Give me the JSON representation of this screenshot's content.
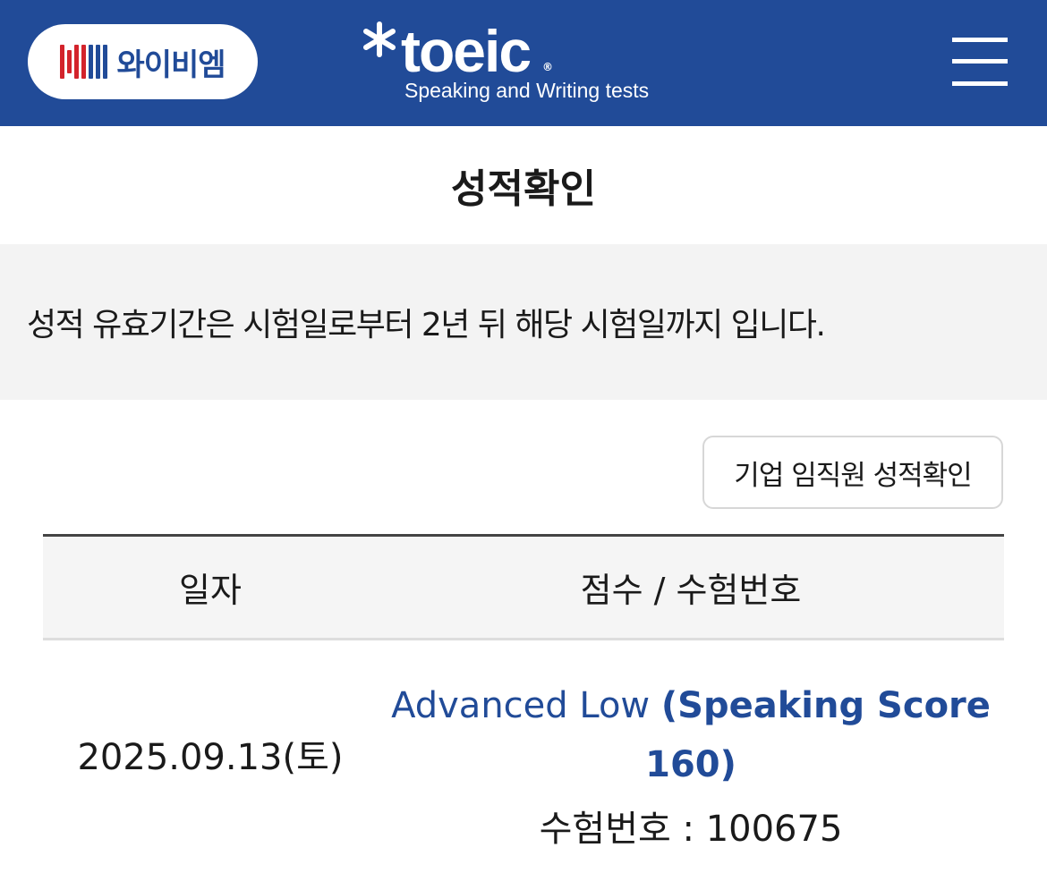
{
  "header": {
    "brand_name": "와이비엠",
    "brand_logo": "YBM",
    "product_logo": "toeic",
    "product_reg": "®",
    "product_subtitle": "Speaking and Writing tests",
    "menu_icon": "hamburger-menu-icon"
  },
  "colors": {
    "brand_blue": "#214b98",
    "ybm_red": "#d3232b",
    "notice_bg": "#f3f3f3",
    "table_head_bg": "#f5f5f5"
  },
  "page": {
    "title": "성적확인"
  },
  "notice": {
    "text": "성적 유효기간은 시험일로부터 2년 뒤 해당 시험일까지 입니다."
  },
  "actions": {
    "corp_check_label": "기업 임직원 성적확인"
  },
  "table": {
    "columns": [
      "일자",
      "점수 / 수험번호"
    ],
    "rows": [
      {
        "date": "2025.09.13(토)",
        "level": "Advanced Low",
        "score_detail_line1": "(Speaking Score",
        "score_detail_line2": "160)",
        "exam_number": "수험번호 : 100675"
      }
    ]
  }
}
